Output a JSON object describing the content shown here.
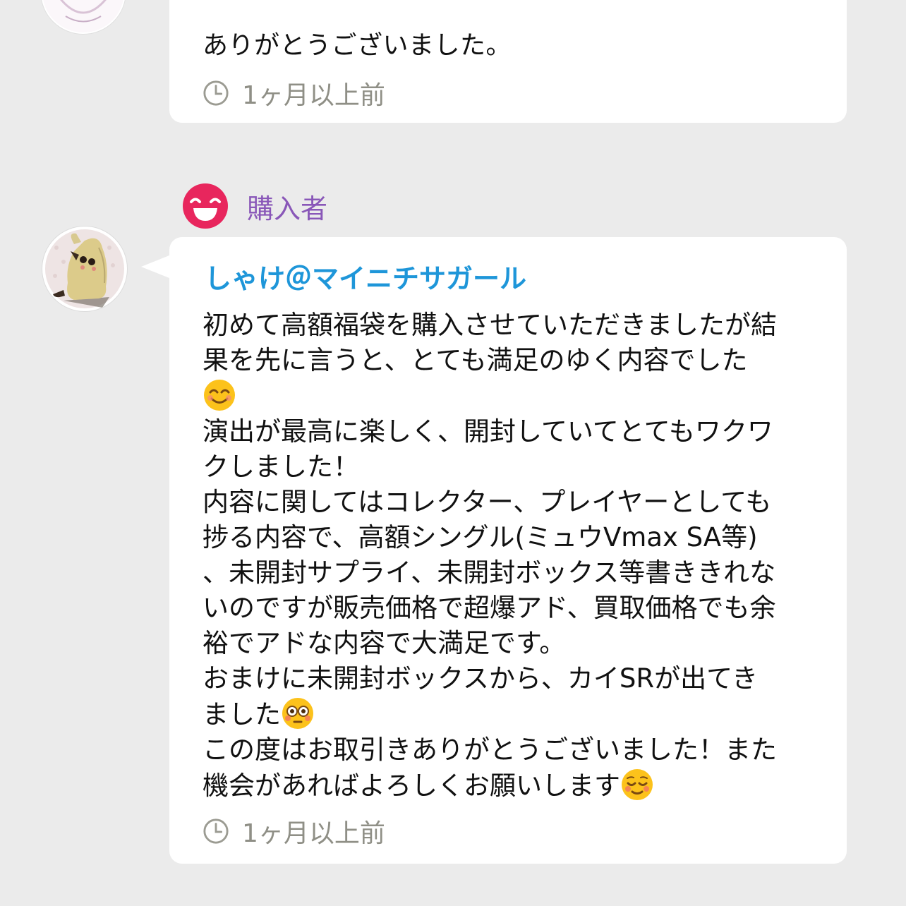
{
  "previous_message": {
    "text": "ありがとうございました。",
    "time": "1ヶ月以上前"
  },
  "review": {
    "role_label": "購入者",
    "sender_name": "しゃけ＠マイニチサガール",
    "lines": [
      "初めて高額福袋を購入させていただきましたが結",
      "果を先に言うと、とても満足のゆく内容でした",
      "",
      "演出が最高に楽しく、開封していてとてもワクワ",
      "クしました！",
      "内容に関してはコレクター、プレイヤーとしても",
      "捗る内容で、高額シングル(ミュウVmax SA等)",
      "、未開封サプライ、未開封ボックス等書ききれな",
      "いのですが販売価格で超爆アド、買取価格でも余",
      "裕でアドな内容で大満足です。",
      "おまけに未開封ボックスから、カイSRが出てき",
      "ました",
      "この度はお取引きありがとうございました！また",
      "機会があればよろしくお願いします"
    ],
    "emojis": [
      "smiling-face-emoji",
      "flushed-face-emoji",
      "relaxed-face-emoji"
    ],
    "time": "1ヶ月以上前"
  },
  "colors": {
    "background": "#ebebeb",
    "sender_name": "#1e96d9",
    "role_label": "#8957b8",
    "role_icon": "#e8265d",
    "timestamp": "#8f8f86"
  }
}
